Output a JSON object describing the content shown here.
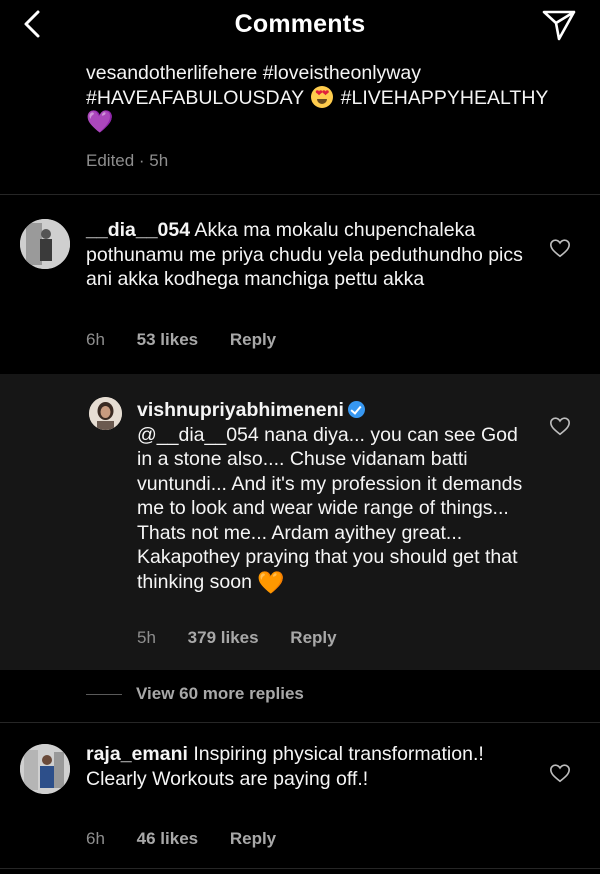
{
  "header": {
    "title": "Comments"
  },
  "caption": {
    "line1": "vesandotherlifehere #loveistheonlyway",
    "line2a": "#HAVEAFABULOUSDAY",
    "line2b": " #LIVEHAPPYHEALTHY",
    "line3_emoji": "💜",
    "meta": "Edited · 5h"
  },
  "comments": [
    {
      "username": "__dia__054",
      "text": " Akka ma mokalu chupenchaleka pothunamu me priya chudu yela peduthundho pics ani akka kodhega manchiga pettu akka",
      "time": "6h",
      "likes": "53 likes",
      "reply_label": "Reply"
    },
    {
      "username": "vishnupriyabhimeneni",
      "mention": "@__dia__054",
      "text": " nana diya... you can see God  in a stone also.... Chuse vidanam batti vuntundi... And it's my profession it demands me to look and wear wide range of things... Thats not me... Ardam ayithey great... Kakapothey praying that you should get that thinking soon ",
      "emoji": "🧡",
      "time": "5h",
      "likes": "379 likes",
      "reply_label": "Reply"
    },
    {
      "username": "raja_emani",
      "text": " Inspiring physical transformation.! Clearly Workouts are paying off.!",
      "time": "6h",
      "likes": "46 likes",
      "reply_label": "Reply"
    }
  ],
  "view_more_replies": "View 60 more replies",
  "colors": {
    "background": "#000000",
    "reply_background": "#161616",
    "secondary_text": "#8e8e8e",
    "verified": "#3797f0"
  }
}
